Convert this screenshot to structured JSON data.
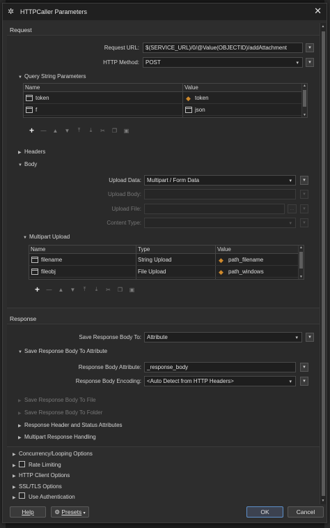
{
  "window": {
    "title": "HTTPCaller Parameters"
  },
  "request": {
    "header": "Request",
    "url_label": "Request URL:",
    "url_value": "$(SERVICE_URL)/0/@Value(OBJECTID)/addAttachment",
    "method_label": "HTTP Method:",
    "method_value": "POST"
  },
  "query": {
    "header": "Query String Parameters",
    "columns": [
      "Name",
      "Value"
    ],
    "rows": [
      {
        "name": "token",
        "value": "token"
      },
      {
        "name": "f",
        "value": "json"
      }
    ]
  },
  "headers_section": "Headers",
  "body": {
    "header": "Body",
    "upload_data_label": "Upload Data:",
    "upload_data_value": "Multipart / Form Data",
    "upload_body_label": "Upload Body:",
    "upload_file_label": "Upload File:",
    "content_type_label": "Content Type:",
    "browse_label": "...",
    "multipart": {
      "header": "Multipart Upload",
      "columns": [
        "Name",
        "Type",
        "Value"
      ],
      "rows": [
        {
          "name": "filename",
          "type": "String Upload",
          "value": "path_filename"
        },
        {
          "name": "fileobj",
          "type": "File Upload",
          "value": "path_windows"
        }
      ]
    }
  },
  "response": {
    "header": "Response",
    "save_to_label": "Save Response Body To:",
    "save_to_value": "Attribute",
    "save_attr_section": "Save Response Body To Attribute",
    "body_attr_label": "Response Body Attribute:",
    "body_attr_value": "_response_body",
    "encoding_label": "Response Body Encoding:",
    "encoding_value": "<Auto Detect from HTTP Headers>",
    "save_to_file": "Save Response Body To File",
    "save_to_folder": "Save Response Body To Folder",
    "header_status": "Response Header and Status Attributes",
    "multipart_handling": "Multipart Response Handling"
  },
  "options": {
    "concurrency": "Concurrency/Looping Options",
    "rate_limiting": "Rate Limiting",
    "http_client": "HTTP Client Options",
    "ssl": "SSL/TLS Options",
    "authentication": "Use Authentication"
  },
  "buttons": {
    "help": "Help",
    "presets": "Presets",
    "ok": "OK",
    "cancel": "Cancel"
  },
  "colors": {
    "attribute_icon": "#d08a2c",
    "ok_border": "#5d8fc9"
  }
}
